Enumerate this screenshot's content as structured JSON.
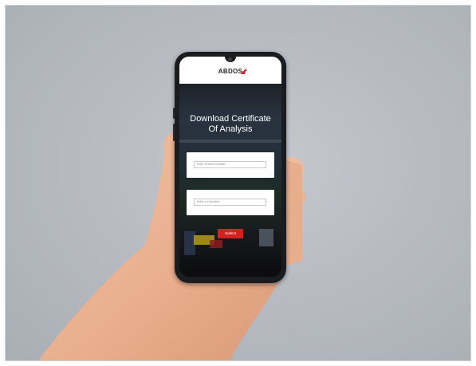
{
  "app": {
    "logo_text": "ABDOS",
    "title_line1": "Download Certificate",
    "title_line2": "Of Analysis"
  },
  "form": {
    "product_placeholder": "Enter Product Number",
    "lot_placeholder": "Enter Lot Number",
    "submit_label": "Submit"
  },
  "colors": {
    "accent": "#d32020",
    "background": "#b8bcc2"
  },
  "icons": {
    "logo_mark": "abdos-logo-icon"
  }
}
